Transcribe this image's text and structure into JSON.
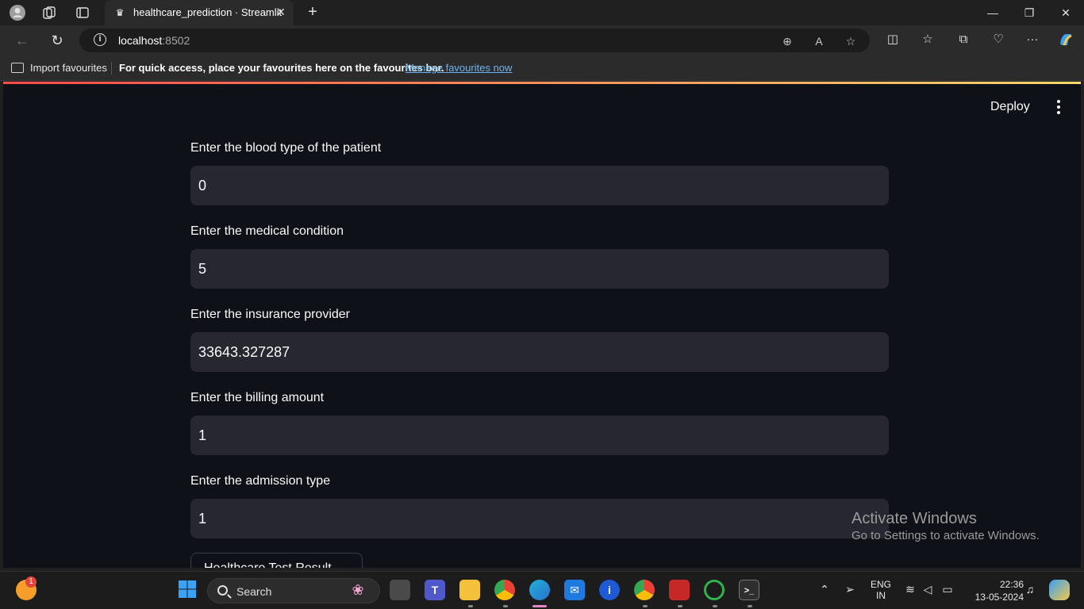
{
  "browser": {
    "tab_title": "healthcare_prediction · Streamlit",
    "tab_close": "✕",
    "new_tab": "+",
    "url_host": "localhost",
    "url_port": ":8502",
    "minimize": "—",
    "restore": "❐",
    "close": "✕"
  },
  "favourites": {
    "import_label": "Import favourites",
    "hint": "For quick access, place your favourites here on the favourites bar.",
    "manage_link": "Manage favourites now"
  },
  "app": {
    "deploy_label": "Deploy",
    "fields": [
      {
        "label": "Enter the blood type of the patient",
        "value": "0"
      },
      {
        "label": "Enter the medical condition",
        "value": "5"
      },
      {
        "label": "Enter the insurance provider",
        "value": "33643.327287"
      },
      {
        "label": "Enter the billing amount",
        "value": "1"
      },
      {
        "label": "Enter the admission type",
        "value": "1"
      }
    ],
    "predict_button": "Healthcare Test Result"
  },
  "watermark": {
    "line1": "Activate Windows",
    "line2": "Go to Settings to activate Windows."
  },
  "taskbar": {
    "search_label": "Search",
    "lang_line1": "ENG",
    "lang_line2": "IN",
    "time": "22:36",
    "date": "13-05-2024",
    "notification_badge": "1"
  },
  "colors": {
    "app_bg": "#0e1117",
    "input_bg": "#262730",
    "text": "#fafafa",
    "link": "#6cb4ee"
  }
}
